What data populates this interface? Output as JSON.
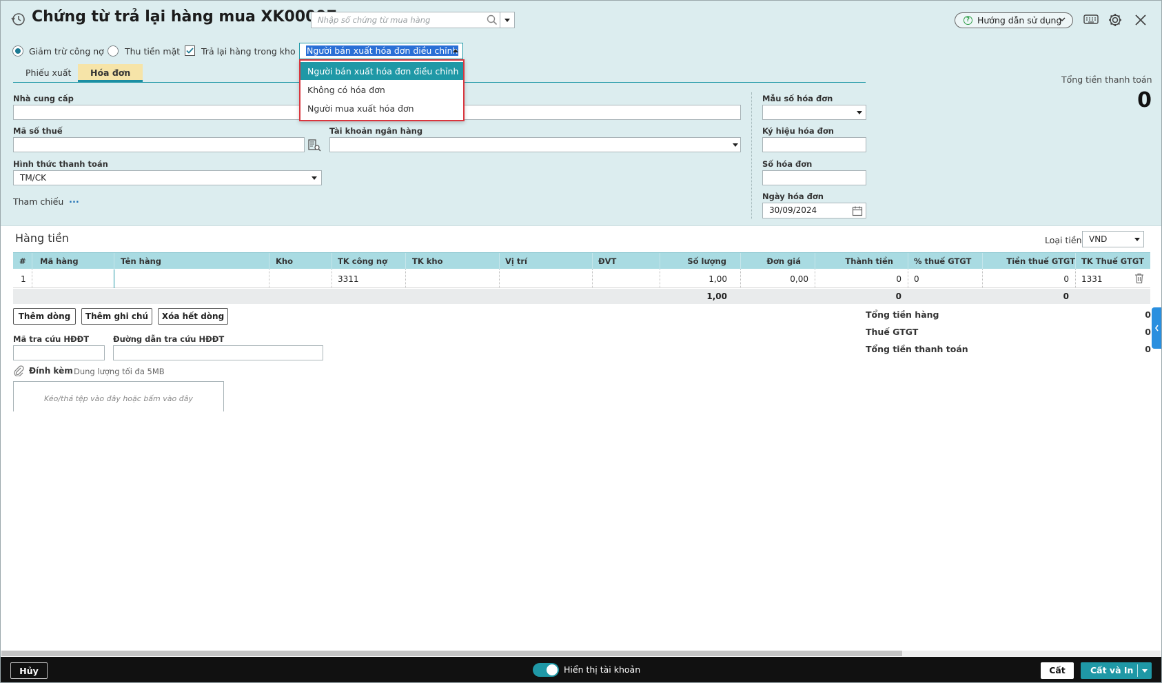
{
  "window": {
    "title": "Chứng từ trả lại hàng mua XK00097",
    "search_placeholder": "Nhập số chứng từ mua hàng",
    "help_label": "Hướng dẫn sử dụng"
  },
  "options": {
    "radio_debt": "Giảm trừ công nợ",
    "radio_cash": "Thu tiền mặt",
    "selected_radio": "Giảm trừ công nợ",
    "checkbox_return_stock": "Trả lại hàng trong kho",
    "checkbox_checked": true,
    "invoice_type_value": "Người bán xuất hóa đơn điều chỉnh",
    "invoice_type_options": [
      "Người bán xuất hóa đơn điều chỉnh",
      "Không có hóa đơn",
      "Người mua xuất hóa đơn"
    ]
  },
  "tabs": [
    "Phiếu xuất",
    "Hóa đơn"
  ],
  "active_tab": "Hóa đơn",
  "total_label": "Tổng tiền thanh toán",
  "total_value": "0",
  "form": {
    "supplier_label": "Nhà cung cấp",
    "tax_code_label": "Mã số thuế",
    "bank_account_label": "Tài khoản ngân hàng",
    "payment_method_label": "Hình thức thanh toán",
    "payment_method_value": "TM/CK",
    "reference_label": "Tham chiếu",
    "reference_more": "...",
    "invoice_template_label": "Mẫu số hóa đơn",
    "invoice_symbol_label": "Ký hiệu hóa đơn",
    "invoice_number_label": "Số hóa đơn",
    "invoice_date_label": "Ngày hóa đơn",
    "invoice_date_value": "30/09/2024"
  },
  "grid": {
    "section_title": "Hàng tiền",
    "currency_label": "Loại tiền",
    "currency_value": "VND",
    "columns": [
      "#",
      "Mã hàng",
      "Tên hàng",
      "Kho",
      "TK công nợ",
      "TK kho",
      "Vị trí",
      "ĐVT",
      "Số lượng",
      "Đơn giá",
      "Thành tiền",
      "% thuế GTGT",
      "Tiền thuế GTGT",
      "TK Thuế GTGT"
    ],
    "rows": [
      [
        "1",
        "",
        "",
        "",
        "3311",
        "",
        "",
        "",
        "1,00",
        "0,00",
        "0",
        "0",
        "0",
        "1331"
      ]
    ],
    "footer": {
      "quantity": "1,00",
      "amount": "0",
      "tax": "0"
    }
  },
  "actions": {
    "add_row": "Thêm dòng",
    "add_note": "Thêm ghi chú",
    "delete_all": "Xóa hết dòng"
  },
  "lookup": {
    "code_label": "Mã tra cứu HĐĐT",
    "url_label": "Đường dẫn tra cứu HĐĐT"
  },
  "attachment": {
    "label": "Đính kèm",
    "limit": "Dung lượng tối đa 5MB",
    "drop_hint": "Kéo/thả tệp vào đây hoặc bấm vào đây"
  },
  "summary": [
    {
      "label": "Tổng tiền hàng",
      "value": "0"
    },
    {
      "label": "Thuế GTGT",
      "value": "0"
    },
    {
      "label": "Tổng tiền thanh toán",
      "value": "0"
    }
  ],
  "footer": {
    "cancel": "Hủy",
    "show_account": "Hiển thị tài khoản",
    "save": "Cất",
    "save_print": "Cất và In"
  },
  "colors": {
    "header_bg": "#dcedef",
    "accent": "#1f98a6",
    "grid_header": "#a9dbe2",
    "footer_bg": "#111111"
  }
}
